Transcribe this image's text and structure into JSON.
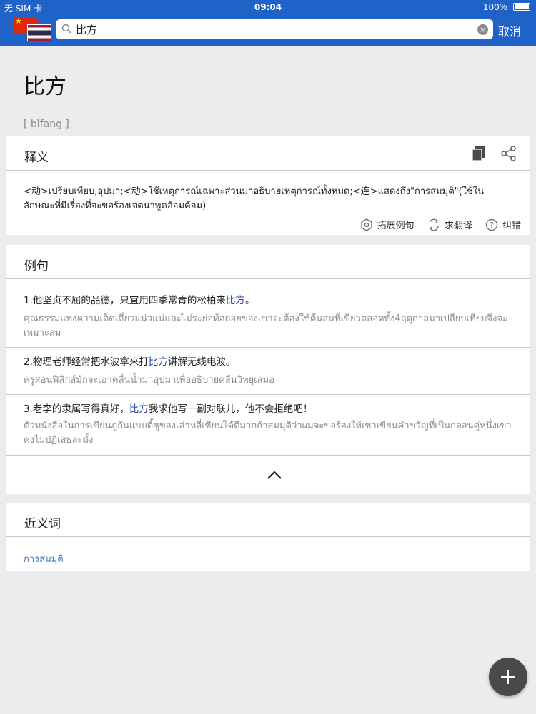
{
  "status": {
    "carrier": "无 SIM 卡",
    "time": "09:04",
    "battery": "100%"
  },
  "header": {
    "flag_left": "china-flag",
    "flag_right": "thailand-flag",
    "search_value": "比方",
    "cancel_label": "取消"
  },
  "entry": {
    "headword": "比方",
    "pinyin": "[ bǐfang ]"
  },
  "definition": {
    "title": "释义",
    "text": "<动>เปรียบเทียบ,อุปมา;<动>ใช้เหตุการณ์เฉพาะส่วนมาอธิบายเหตุการณ์ทั้งหมด;<连>แสดงถึง\"การสมมุติ\"(ใช้ในลักษณะที่มีเรื่องที่จะขอร้องเจตนาพูดอ้อมค้อม)",
    "tools": [
      {
        "label": "拓展例句",
        "icon": "expand-examples-icon"
      },
      {
        "label": "求翻译",
        "icon": "request-translation-icon"
      },
      {
        "label": "纠错",
        "icon": "report-error-icon"
      }
    ]
  },
  "examples": {
    "title": "例句",
    "items": [
      {
        "zh_before": "1.他坚贞不屈的品德，只宜用四季常青的松柏来",
        "zh_hl": "比方",
        "zh_after": "。",
        "th": "คุณธรรมแห่งความเด็ดเดี่ยวแน่วแน่และไม่ระย่อท้อถอยของเขาจะต้องใช้ต้นสนที่เขียวตลอดทั้ง4ฤดูกาลมาเปลียบเทียบจึงจะเหมาะสม"
      },
      {
        "zh_before": "2.物理老师经常把水波拿来打",
        "zh_hl": "比方",
        "zh_after": "讲解无线电波。",
        "th": "ครูสอนฟิสิกส์มักจะเอาคลื่นน้ำมาอุปมาเพื่ออธิบายคลื่นวิทยุเสมอ"
      },
      {
        "zh_before": "3.老李的隶属写得真好，",
        "zh_hl": "比方",
        "zh_after": "我求他写一副对联儿，他不会拒绝吧！",
        "th": "ตัวหนังสือในการเขียนภู่กันแบบตี้ชูของเล่าหลี่เขียนได้ดีมากถ้าสมมุติว่าผมจะขอร้องให้เขาเขียนคำขวัญที่เป็นกลอนคู่หนึ่งเขาคงไม่ปฏิเสธละมั้ง"
      }
    ]
  },
  "synonyms": {
    "title": "近义词",
    "items": [
      "การสมมุติ"
    ]
  }
}
